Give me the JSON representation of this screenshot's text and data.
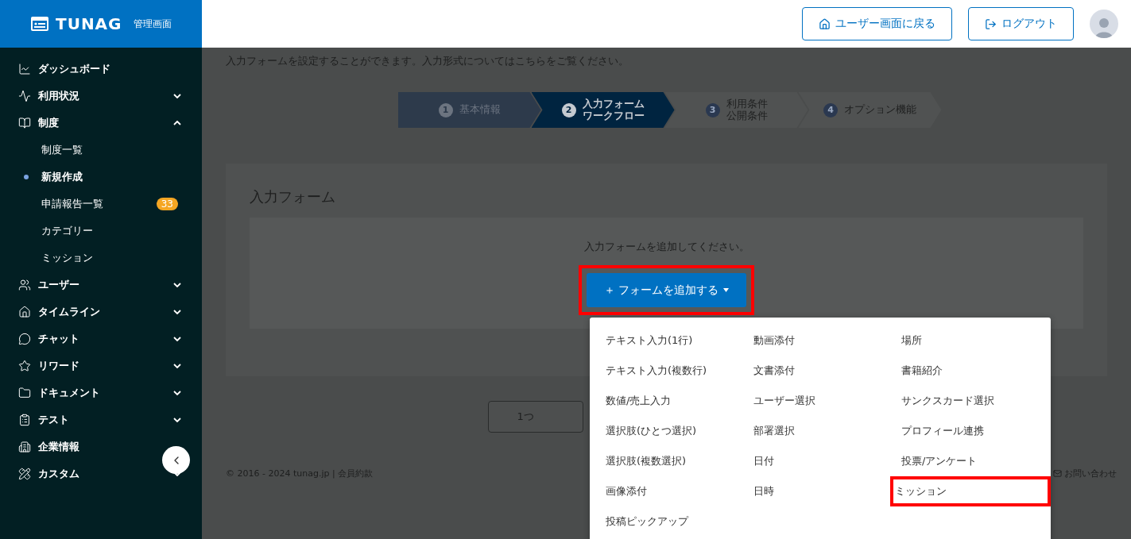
{
  "logo": {
    "brand": "TUNAG",
    "subtitle": "管理画面"
  },
  "sidebar": {
    "items": [
      {
        "label": "ダッシュボード"
      },
      {
        "label": "利用状況",
        "expanded": false
      },
      {
        "label": "制度",
        "expanded": true,
        "children": [
          {
            "label": "制度一覧",
            "selected": false
          },
          {
            "label": "新規作成",
            "selected": true
          },
          {
            "label": "申請報告一覧",
            "selected": false,
            "badge": "33"
          },
          {
            "label": "カテゴリー",
            "selected": false
          },
          {
            "label": "ミッション",
            "selected": false
          }
        ]
      },
      {
        "label": "ユーザー",
        "expanded": false
      },
      {
        "label": "タイムライン",
        "expanded": false
      },
      {
        "label": "チャット",
        "expanded": false
      },
      {
        "label": "リワード",
        "expanded": false
      },
      {
        "label": "ドキュメント",
        "expanded": false
      },
      {
        "label": "テスト",
        "expanded": false
      },
      {
        "label": "企業情報"
      },
      {
        "label": "カスタム",
        "expanded": false
      }
    ]
  },
  "header": {
    "buttons": [
      {
        "label": "ユーザー画面に戻る"
      },
      {
        "label": "ログアウト"
      }
    ]
  },
  "description": "入力フォームを設定することができます。入力形式についてはこちらをご覧ください。",
  "steps": [
    {
      "number": "1",
      "lines": [
        "基本情報"
      ],
      "done": true,
      "selected": false
    },
    {
      "number": "2",
      "lines": [
        "入力フォーム",
        "ワークフロー"
      ],
      "done": false,
      "selected": true
    },
    {
      "number": "3",
      "lines": [
        "利用条件",
        "公開条件"
      ],
      "done": false,
      "selected": false
    },
    {
      "number": "4",
      "lines": [
        "オプション機能"
      ],
      "done": false,
      "selected": false
    }
  ],
  "form_card": {
    "title": "入力フォーム",
    "empty_message": "入力フォームを追加してください。",
    "add_button": {
      "label": "＋ フォームを追加する",
      "highlighted": true
    }
  },
  "back_button": "1つ",
  "footer": {
    "copyright": "© 2016 - 2024 tunag.jp | 会員約款",
    "contact": "お問い合わせ"
  },
  "dropdown": {
    "items": [
      {
        "label": "テキスト入力(1行)",
        "highlighted": false
      },
      {
        "label": "動画添付",
        "highlighted": false
      },
      {
        "label": "場所",
        "highlighted": false
      },
      {
        "label": "テキスト入力(複数行)",
        "highlighted": false
      },
      {
        "label": "文書添付",
        "highlighted": false
      },
      {
        "label": "書籍紹介",
        "highlighted": false
      },
      {
        "label": "数値/売上入力",
        "highlighted": false
      },
      {
        "label": "ユーザー選択",
        "highlighted": false
      },
      {
        "label": "サンクスカード選択",
        "highlighted": false
      },
      {
        "label": "選択肢(ひとつ選択)",
        "highlighted": false
      },
      {
        "label": "部署選択",
        "highlighted": false
      },
      {
        "label": "プロフィール連携",
        "highlighted": false
      },
      {
        "label": "選択肢(複数選択)",
        "highlighted": false
      },
      {
        "label": "日付",
        "highlighted": false
      },
      {
        "label": "投票/アンケート",
        "highlighted": false
      },
      {
        "label": "画像添付",
        "highlighted": false
      },
      {
        "label": "日時",
        "highlighted": false
      },
      {
        "label": "ミッション",
        "highlighted": true
      },
      {
        "label": "投稿ピックアップ",
        "highlighted": false
      }
    ]
  }
}
